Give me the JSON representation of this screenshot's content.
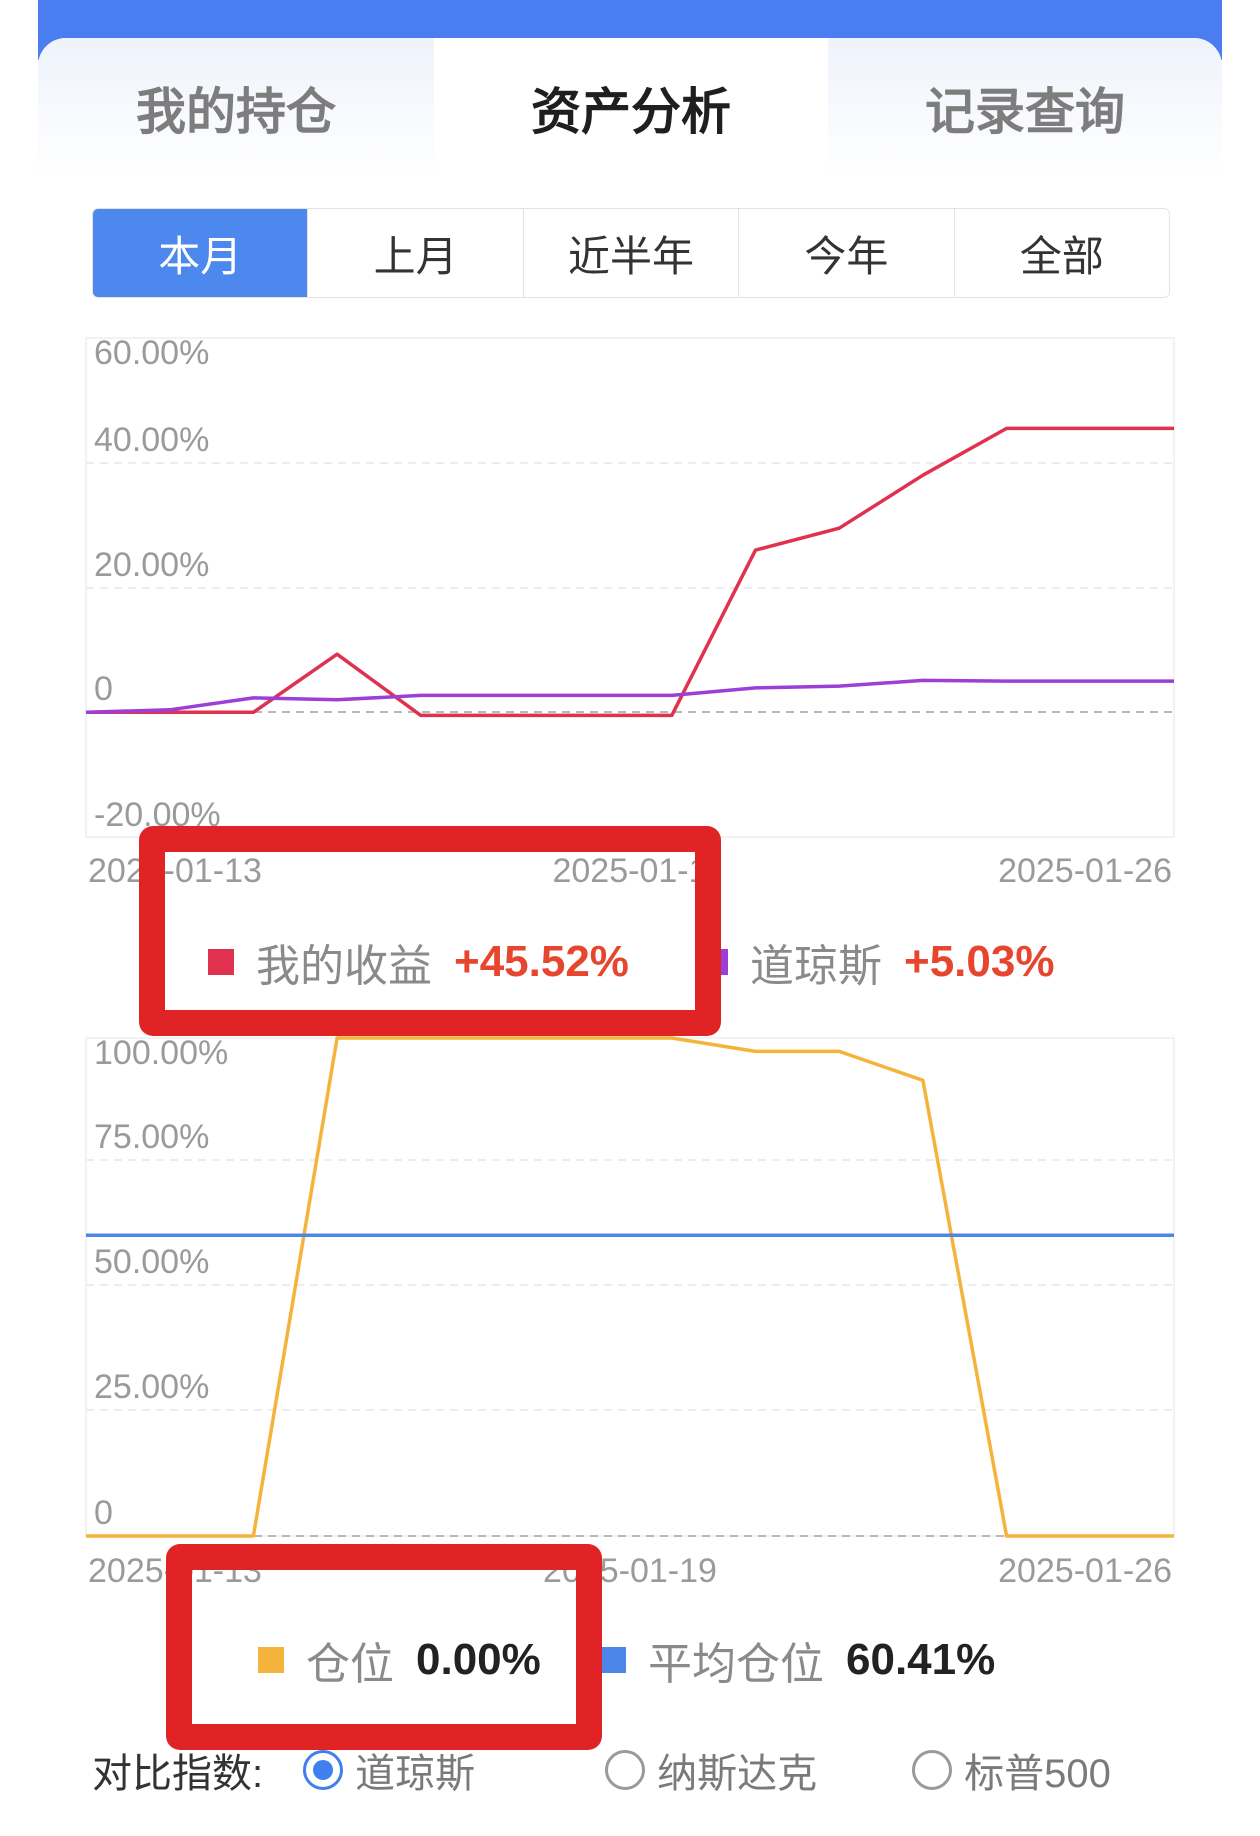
{
  "tabs": [
    {
      "label": "我的持仓"
    },
    {
      "label": "资产分析"
    },
    {
      "label": "记录查询"
    }
  ],
  "periods": [
    {
      "label": "本月"
    },
    {
      "label": "上月"
    },
    {
      "label": "近半年"
    },
    {
      "label": "今年"
    },
    {
      "label": "全部"
    }
  ],
  "colors": {
    "accent": "#4d88ee",
    "my_return": "#e0314f",
    "index": "#9b3fd6",
    "position": "#f4b43c",
    "avg_position": "#4c86e8",
    "highlight_box": "#e02425",
    "positive": "#e8452f"
  },
  "chart_data": [
    {
      "type": "line",
      "y_ticks": [
        "60.00%",
        "40.00%",
        "20.00%",
        "0",
        "-20.00%"
      ],
      "x_ticks": [
        "2025-01-13",
        "2025-01-1",
        "2025-01-26"
      ],
      "ylim": [
        -20,
        60
      ],
      "series": [
        {
          "name": "我的收益",
          "values": [
            0,
            0,
            0,
            9.3,
            -0.5,
            -0.5,
            -0.5,
            -0.5,
            26,
            29.5,
            38,
            45.5,
            45.5,
            45.5
          ]
        },
        {
          "name": "道琼斯",
          "values": [
            0,
            0.4,
            2.3,
            2.0,
            2.7,
            2.7,
            2.7,
            2.7,
            3.9,
            4.2,
            5.1,
            5.0,
            5.0,
            5.0
          ]
        }
      ],
      "legend": [
        {
          "name": "我的收益",
          "value": "+45.52%"
        },
        {
          "name": "道琼斯",
          "value": "+5.03%"
        }
      ]
    },
    {
      "type": "line",
      "y_ticks": [
        "100.00%",
        "75.00%",
        "50.00%",
        "25.00%",
        "0"
      ],
      "x_ticks": [
        "2025-01-13",
        "2025-01-19",
        "2025-01-26"
      ],
      "ylim": [
        0,
        100
      ],
      "series": [
        {
          "name": "仓位",
          "values": [
            0,
            0,
            0,
            100,
            100,
            100,
            100,
            100,
            97.3,
            97.3,
            91.5,
            0,
            0,
            0
          ]
        },
        {
          "name": "平均仓位",
          "values": [
            60.41,
            60.41,
            60.41,
            60.41,
            60.41,
            60.41,
            60.41,
            60.41,
            60.41,
            60.41,
            60.41,
            60.41,
            60.41,
            60.41
          ]
        }
      ],
      "legend": [
        {
          "name": "仓位",
          "value": "0.00%"
        },
        {
          "name": "平均仓位",
          "value": "60.41%"
        }
      ]
    }
  ],
  "compare": {
    "label": "对比指数:",
    "options": [
      "道琼斯",
      "纳斯达克",
      "标普500"
    ],
    "selected": "道琼斯"
  }
}
